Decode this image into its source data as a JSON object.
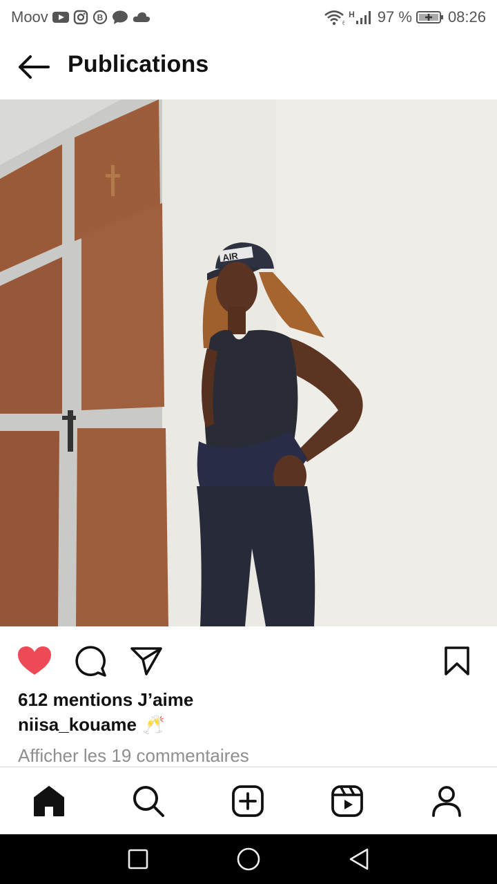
{
  "status_bar": {
    "carrier": "Moov",
    "battery": "97 %",
    "time": "08:26",
    "network_label": "H",
    "icons": [
      "youtube-icon",
      "instagram-icon",
      "b-icon",
      "chat-bubble-icon",
      "cloud-icon",
      "wifi-icon",
      "signal-icon",
      "battery-icon"
    ]
  },
  "header": {
    "title": "Publications",
    "back_icon": "arrow-left-icon"
  },
  "post": {
    "image_alt": "Photo",
    "cap_text": "AIR",
    "liked": true,
    "like_color": "#ed4956",
    "likes_text": "612 mentions J’aime",
    "username": "niisa_kouame",
    "caption_emoji": "🥂",
    "comments_text": "Afficher les 19 commentaires"
  },
  "actions": [
    "heart-icon",
    "comment-icon",
    "share-icon",
    "bookmark-icon"
  ],
  "bottom_nav": [
    "home-icon",
    "search-icon",
    "create-icon",
    "reels-icon",
    "profile-icon"
  ],
  "system_nav": [
    "recent-apps-icon",
    "home-circle-icon",
    "back-triangle-icon"
  ]
}
